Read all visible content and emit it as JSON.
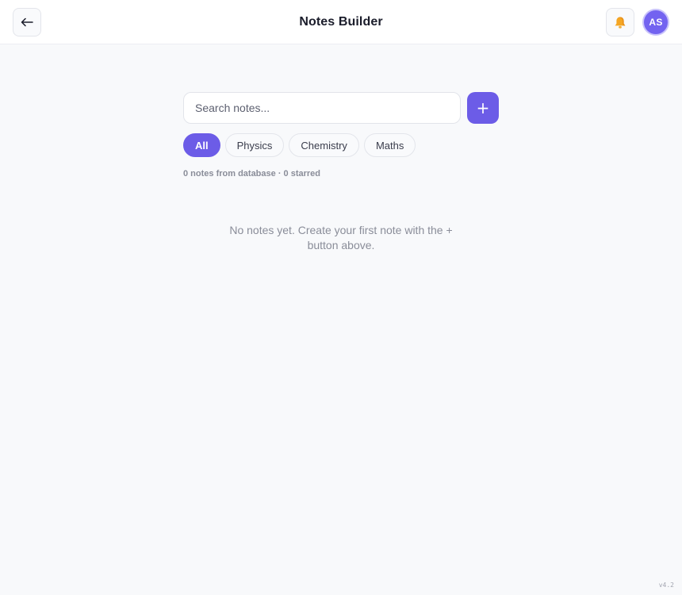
{
  "header": {
    "title": "Notes Builder",
    "back_icon": "arrow-left-icon",
    "bell_icon": "bell-icon",
    "avatar_initials": "AS"
  },
  "search": {
    "placeholder": "Search notes...",
    "value": "",
    "add_label": "+"
  },
  "filters": {
    "active": "All",
    "items": [
      {
        "label": "All"
      },
      {
        "label": "Physics"
      },
      {
        "label": "Chemistry"
      },
      {
        "label": "Maths"
      }
    ]
  },
  "summary": "0 notes from database · 0 starred",
  "empty_state": "No notes yet. Create your first note with the + button above.",
  "version": "v4.2",
  "colors": {
    "accent": "#6c5ce7",
    "bell": "#f5a623",
    "muted_text": "#8a8d99"
  }
}
